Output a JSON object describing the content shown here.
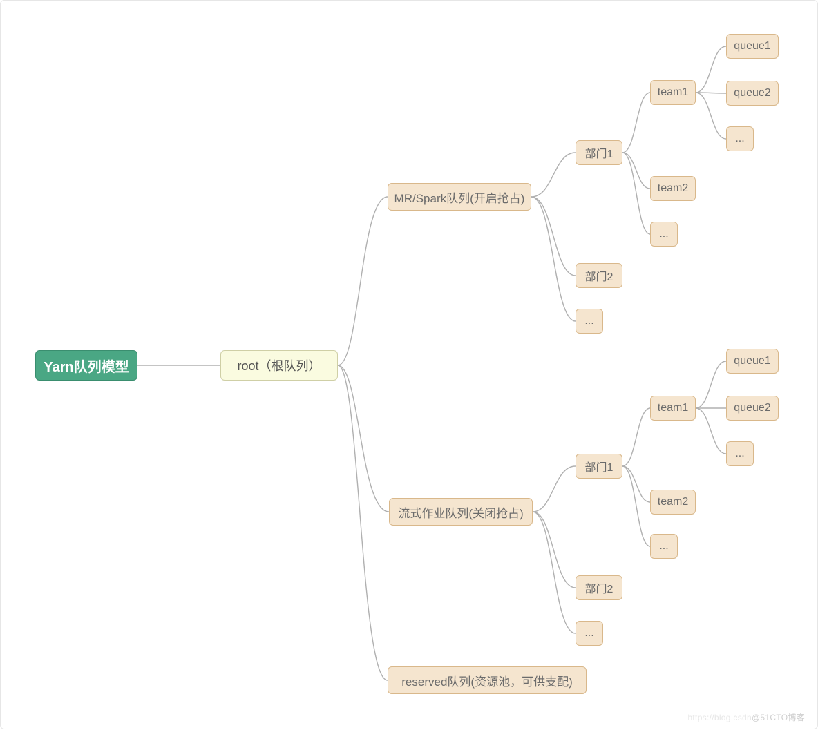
{
  "title": "Yarn队列模型",
  "root": "root（根队列）",
  "mrspark": "MR/Spark队列(开启抢占)",
  "stream": "流式作业队列(关闭抢占)",
  "reserved": "reserved队列(资源池，可供支配)",
  "dept1": "部门1",
  "dept2": "部门2",
  "team1": "team1",
  "team2": "team2",
  "queue1": "queue1",
  "queue2": "queue2",
  "ellipsis": "...",
  "watermark_left": "https://blog.csdn",
  "watermark_right": "@51CTO博客",
  "colors": {
    "rootFill": "#4aa784",
    "yellowFill": "#fafbe0",
    "tanFill": "#f5e5cf",
    "connector": "#b0b0b0"
  },
  "chart_data": {
    "type": "tree",
    "title": "Yarn队列模型",
    "root": {
      "label": "Yarn队列模型",
      "children": [
        {
          "label": "root（根队列）",
          "children": [
            {
              "label": "MR/Spark队列(开启抢占)",
              "children": [
                {
                  "label": "部门1",
                  "children": [
                    {
                      "label": "team1",
                      "children": [
                        {
                          "label": "queue1"
                        },
                        {
                          "label": "queue2"
                        },
                        {
                          "label": "..."
                        }
                      ]
                    },
                    {
                      "label": "team2"
                    },
                    {
                      "label": "..."
                    }
                  ]
                },
                {
                  "label": "部门2"
                },
                {
                  "label": "..."
                }
              ]
            },
            {
              "label": "流式作业队列(关闭抢占)",
              "children": [
                {
                  "label": "部门1",
                  "children": [
                    {
                      "label": "team1",
                      "children": [
                        {
                          "label": "queue1"
                        },
                        {
                          "label": "queue2"
                        },
                        {
                          "label": "..."
                        }
                      ]
                    },
                    {
                      "label": "team2"
                    },
                    {
                      "label": "..."
                    }
                  ]
                },
                {
                  "label": "部门2"
                },
                {
                  "label": "..."
                }
              ]
            },
            {
              "label": "reserved队列(资源池，可供支配)"
            }
          ]
        }
      ]
    }
  }
}
